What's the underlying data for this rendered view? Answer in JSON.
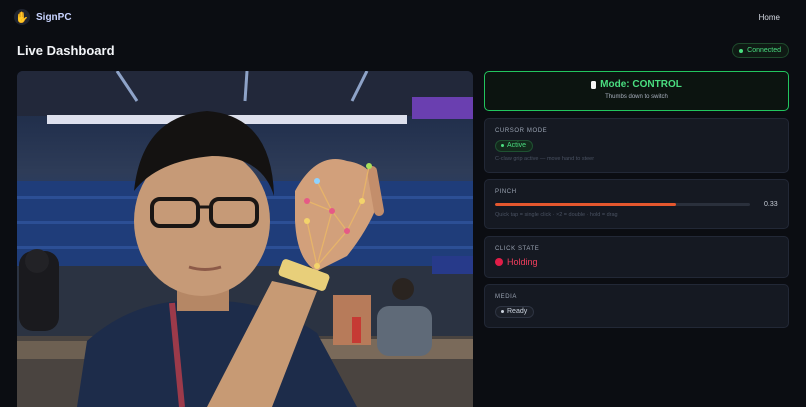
{
  "header": {
    "brand_icon": "waving-hand-icon",
    "brand_name": "SignPC",
    "nav_home": "Home"
  },
  "page": {
    "title": "Live Dashboard",
    "status": "Connected"
  },
  "video": {
    "tracker_glyph": "🔥 ✺"
  },
  "mode": {
    "icon": "white-rectangle-icon",
    "title": "Mode: CONTROL",
    "hint": "Thumbs down to switch"
  },
  "cursor": {
    "label": "CURSOR MODE",
    "badge": "Active",
    "hint": "C-claw grip active — move hand to steer"
  },
  "pinch": {
    "label": "PINCH",
    "value_text": "0.33",
    "level": 0.71,
    "hint": "Quick tap = single click · ×2 = double · hold = drag"
  },
  "click": {
    "label": "CLICK STATE",
    "state": "Holding",
    "icon": "red-circle-icon"
  },
  "media": {
    "label": "MEDIA",
    "badge": "Ready"
  },
  "colors": {
    "accent_green": "#4ade80",
    "pinch_fill": "#e4572e",
    "holding_red": "#f43f5e"
  }
}
